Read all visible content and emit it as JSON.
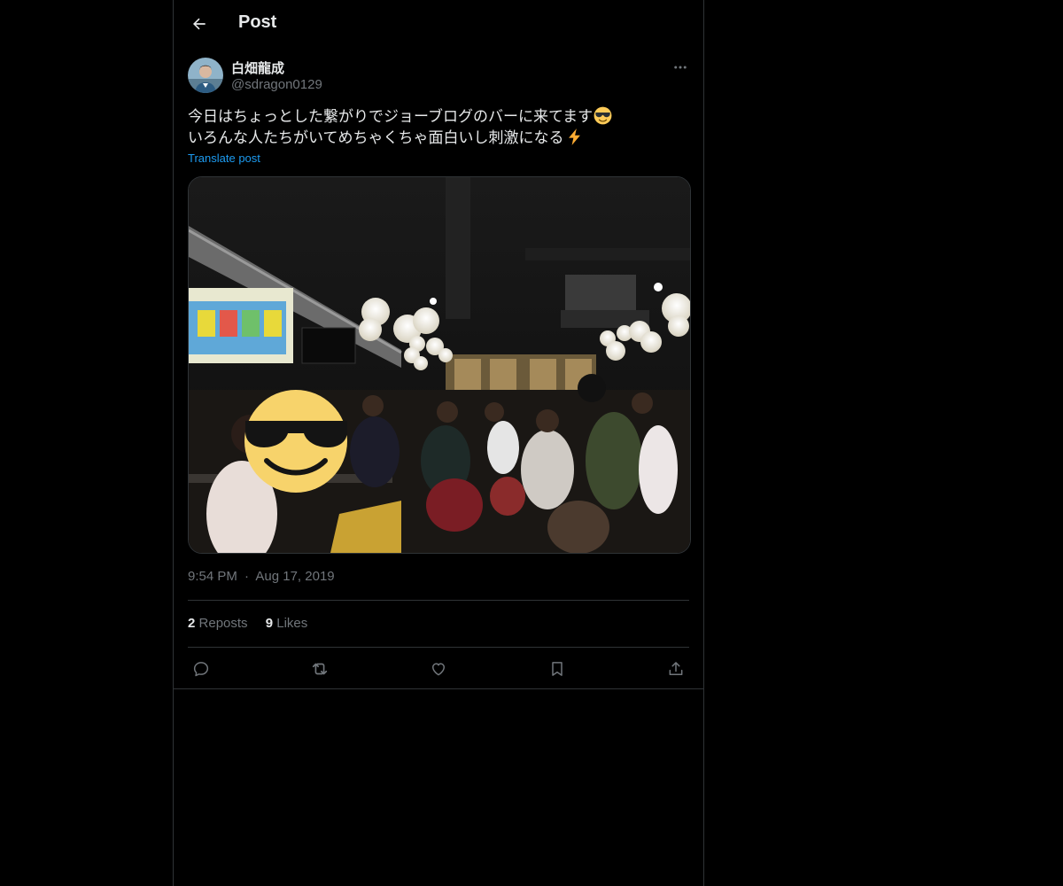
{
  "header": {
    "title": "Post",
    "back_icon": "arrow-left-icon"
  },
  "author": {
    "display_name": "白畑龍成",
    "handle": "@sdragon0129",
    "avatar": "user-avatar"
  },
  "post": {
    "text_line_1": "今日はちょっとした繋がりでジョーブログのバーに来てます",
    "text_line_1_emoji": "smiling-face-with-sunglasses",
    "text_line_2": "いろんな人たちがいてめちゃくちゃ面白いし刺激になる",
    "text_line_2_emoji": "high-voltage",
    "translate_label": "Translate post",
    "media_description_icon": "photo-bar-crowd"
  },
  "meta": {
    "time": "9:54 PM",
    "separator": "·",
    "date": "Aug 17, 2019"
  },
  "stats": {
    "reposts_count": "2",
    "reposts_label": "Reposts",
    "likes_count": "9",
    "likes_label": "Likes"
  },
  "actions": [
    "reply-icon",
    "repost-icon",
    "like-icon",
    "bookmark-icon",
    "share-icon"
  ],
  "colors": {
    "background": "#000000",
    "text": "#e7e9ea",
    "secondary": "#71767b",
    "border": "#2f3336",
    "link": "#1d9bf0"
  }
}
